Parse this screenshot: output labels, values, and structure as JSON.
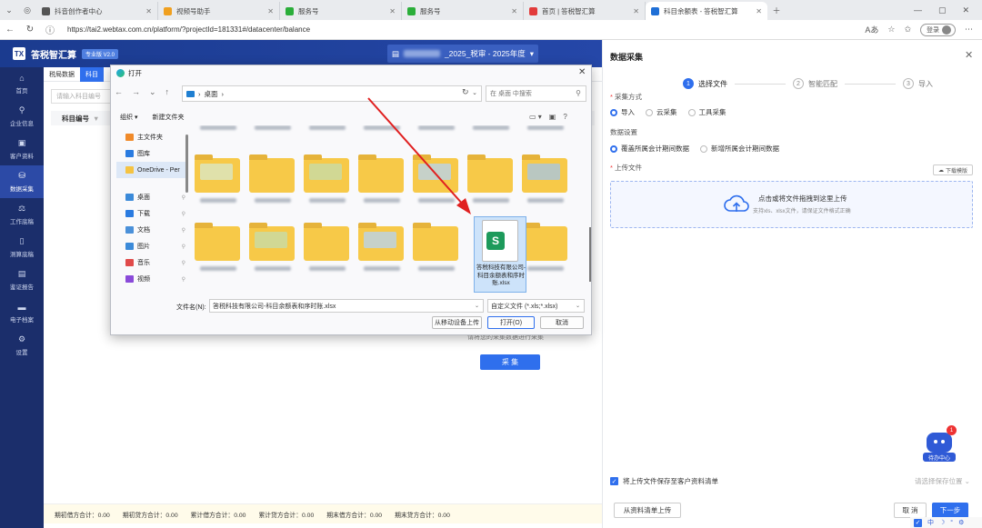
{
  "browser": {
    "tabs": [
      {
        "label": "抖音创作者中心",
        "color": "#555555",
        "active": false
      },
      {
        "label": "视频号助手",
        "color": "#f0a020",
        "active": false
      },
      {
        "label": "服务号",
        "color": "#2bae3a",
        "active": false
      },
      {
        "label": "服务号",
        "color": "#2bae3a",
        "active": false
      },
      {
        "label": "首页 | 答税智汇算",
        "color": "#e23b3b",
        "active": false
      },
      {
        "label": "科目余额表 - 答税智汇算",
        "color": "#1f6fd6",
        "active": true
      }
    ],
    "url": "https://tai2.webtax.com.cn/platform/?projectId=181331#/datacenter/balance",
    "login_label": "登录"
  },
  "app": {
    "logo_text": "TX",
    "title": "答税智汇算",
    "version": "专业版 V2.0",
    "project_suffix": "_2025_税审 - 2025年度"
  },
  "sidebar": {
    "items": [
      {
        "label": "首页",
        "icon": "⌂",
        "active": false
      },
      {
        "label": "企业信息",
        "icon": "⚲",
        "active": false
      },
      {
        "label": "客户资料",
        "icon": "▣",
        "active": false
      },
      {
        "label": "数据采集",
        "icon": "⛁",
        "active": true
      },
      {
        "label": "工作底稿",
        "icon": "⚖",
        "active": false
      },
      {
        "label": "测算底稿",
        "icon": "▯",
        "active": false
      },
      {
        "label": "鉴证报告",
        "icon": "▤",
        "active": false
      },
      {
        "label": "电子档案",
        "icon": "▬",
        "active": false
      },
      {
        "label": "设置",
        "icon": "⚙",
        "active": false
      }
    ]
  },
  "main": {
    "subtabs": [
      {
        "label": "税局数据",
        "active": false
      },
      {
        "label": "科目",
        "active": true
      }
    ],
    "search_placeholder": "请输入科目编号",
    "column_header": "科目编号",
    "hint_text": "请将您的采集数据进行采集",
    "collect_button": "采 集",
    "sums": [
      "期初借方合计：0.00",
      "期初贷方合计：0.00",
      "累计借方合计：0.00",
      "累计贷方合计：0.00",
      "期末借方合计：0.00",
      "期末贷方合计：0.00"
    ]
  },
  "drawer": {
    "title": "数据采集",
    "steps": [
      {
        "num": "1",
        "label": "选择文件",
        "active": true
      },
      {
        "num": "2",
        "label": "智能匹配",
        "active": false
      },
      {
        "num": "3",
        "label": "导入",
        "active": false
      }
    ],
    "method_label": "采集方式",
    "methods": [
      {
        "label": "导入",
        "on": true
      },
      {
        "label": "云采集",
        "on": false
      },
      {
        "label": "工具采集",
        "on": false
      }
    ],
    "data_setting_label": "数据设置",
    "settings": [
      {
        "label": "覆盖所属会计期间数据",
        "on": true
      },
      {
        "label": "新增所属会计期间数据",
        "on": false
      }
    ],
    "upload_label": "上传文件",
    "template_button": "下载模版",
    "dropzone_main": "点击或将文件拖拽到这里上传",
    "dropzone_sub": "支持xls、xlsx文件，请保证文件格式正确",
    "assistant_label": "待办中心",
    "assistant_badge": "1",
    "save_checkbox_label": "将上传文件保存至客户资料清单",
    "save_location_placeholder": "请选择保存位置",
    "from_list_button": "从资料清单上传",
    "cancel_button": "取 消",
    "next_button": "下一步",
    "tray_icons": [
      "中",
      "☽",
      "°",
      "⚙"
    ]
  },
  "dialog": {
    "title": "打开",
    "path": "桌面",
    "search_placeholder": "在 桌面 中搜索",
    "organize": "组织 ▾",
    "new_folder": "新建文件夹",
    "side_items": [
      {
        "label": "主文件夹",
        "color": "#f08a2a"
      },
      {
        "label": "图库",
        "color": "#2a7be0"
      },
      {
        "label": "OneDrive - Per",
        "color": "#f5c342"
      },
      {
        "label": "桌面",
        "color": "#3b8ad9"
      },
      {
        "label": "下载",
        "color": "#2a7be0"
      },
      {
        "label": "文档",
        "color": "#4a90d9"
      },
      {
        "label": "图片",
        "color": "#3b8ad9"
      },
      {
        "label": "音乐",
        "color": "#e04a4a"
      },
      {
        "label": "视频",
        "color": "#8a4ad9"
      }
    ],
    "selected_file": "答税科技有限公司-科目余额表和序时账.xlsx",
    "filename_label": "文件名(N):",
    "filename_value": "答税科技有限公司-科目余额表和序时账.xlsx",
    "filter_value": "自定义文件 (*.xls;*.xlsx)",
    "upload_from_device": "从移动设备上传",
    "open_button": "打开(O)",
    "cancel_button": "取消"
  }
}
